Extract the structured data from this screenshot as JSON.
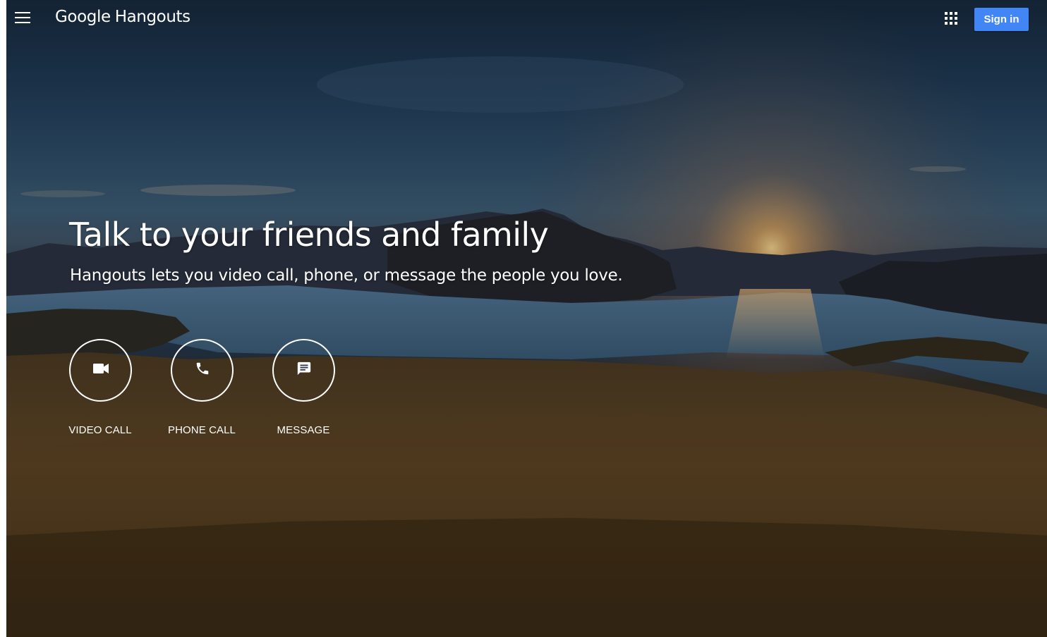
{
  "header": {
    "menu_icon": "hamburger-menu-icon",
    "logo_brand": "Google",
    "logo_product": "Hangouts",
    "apps_icon": "apps-grid-icon",
    "signin_label": "Sign in"
  },
  "hero": {
    "headline": "Talk to your friends and family",
    "subhead": "Hangouts lets you video call, phone, or message the people you love."
  },
  "actions": [
    {
      "label": "VIDEO CALL",
      "icon": "video-camera-icon"
    },
    {
      "label": "PHONE CALL",
      "icon": "phone-icon"
    },
    {
      "label": "MESSAGE",
      "icon": "message-icon"
    }
  ],
  "colors": {
    "signin_button": "#4285f4",
    "text": "#ffffff"
  }
}
